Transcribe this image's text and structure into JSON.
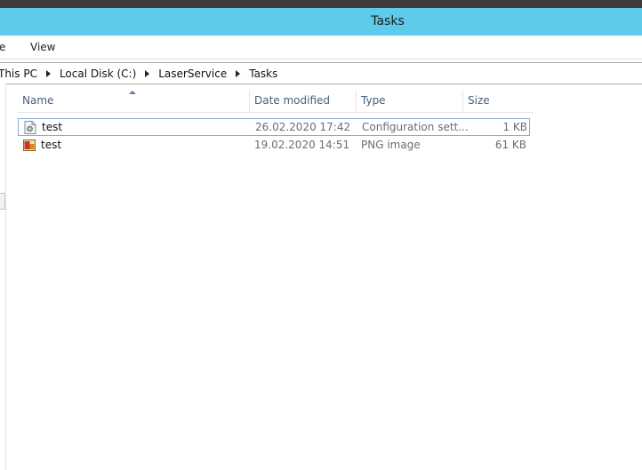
{
  "window": {
    "title": "Tasks"
  },
  "ribbon": {
    "tabs": [
      {
        "label": "e"
      },
      {
        "label": "View"
      }
    ]
  },
  "address": {
    "crumbs": [
      "This PC",
      "Local Disk (C:)",
      "LaserService",
      "Tasks"
    ]
  },
  "columns": {
    "name": "Name",
    "date": "Date modified",
    "type": "Type",
    "size": "Size"
  },
  "files": [
    {
      "name": "test",
      "date": "26.02.2020 17:42",
      "type": "Configuration sett...",
      "size": "1 KB",
      "icon": "config-file-icon",
      "selected": true
    },
    {
      "name": "test",
      "date": "19.02.2020 14:51",
      "type": "PNG image",
      "size": "61 KB",
      "icon": "png-image-icon",
      "selected": false
    }
  ],
  "colors": {
    "titlebar": "#5fcbea",
    "selection_border": "#84acdd",
    "header_text": "#4c607a"
  }
}
